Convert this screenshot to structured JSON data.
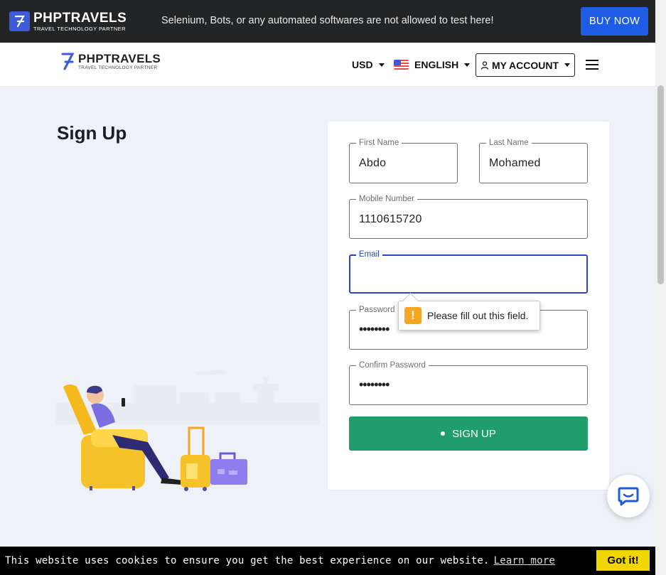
{
  "topbar": {
    "brand": "PHPTRAVELS",
    "tagline": "TRAVEL TECHNOLOGY PARTNER",
    "notice": "Selenium, Bots, or any automated softwares are not allowed to test here!",
    "buy_now": "BUY NOW"
  },
  "navbar": {
    "brand": "PHPTRAVELS",
    "tagline": "TRAVEL TECHNOLOGY PARTNER",
    "currency": "USD",
    "language": "ENGLISH",
    "account": "MY ACCOUNT"
  },
  "page": {
    "title": "Sign Up"
  },
  "form": {
    "first_name": {
      "label": "First Name",
      "value": "Abdo"
    },
    "last_name": {
      "label": "Last Name",
      "value": "Mohamed"
    },
    "mobile": {
      "label": "Mobile Number",
      "value": "1110615720"
    },
    "email": {
      "label": "Email",
      "value": ""
    },
    "password": {
      "label": "Password",
      "value": "••••••••"
    },
    "confirm_password": {
      "label": "Confirm Password",
      "value": "••••••••"
    },
    "submit": "SIGN UP"
  },
  "validation": {
    "message": "Please fill out this field.",
    "icon": "!"
  },
  "cookie": {
    "text": "This website uses cookies to ensure you get the best experience on our website.",
    "link": "Learn more",
    "button": "Got it!"
  },
  "colors": {
    "accent_blue": "#1f5ce5",
    "signup_green": "#1f9d6a",
    "focus_blue": "#2a48c4",
    "cookie_yellow": "#f1d600"
  }
}
